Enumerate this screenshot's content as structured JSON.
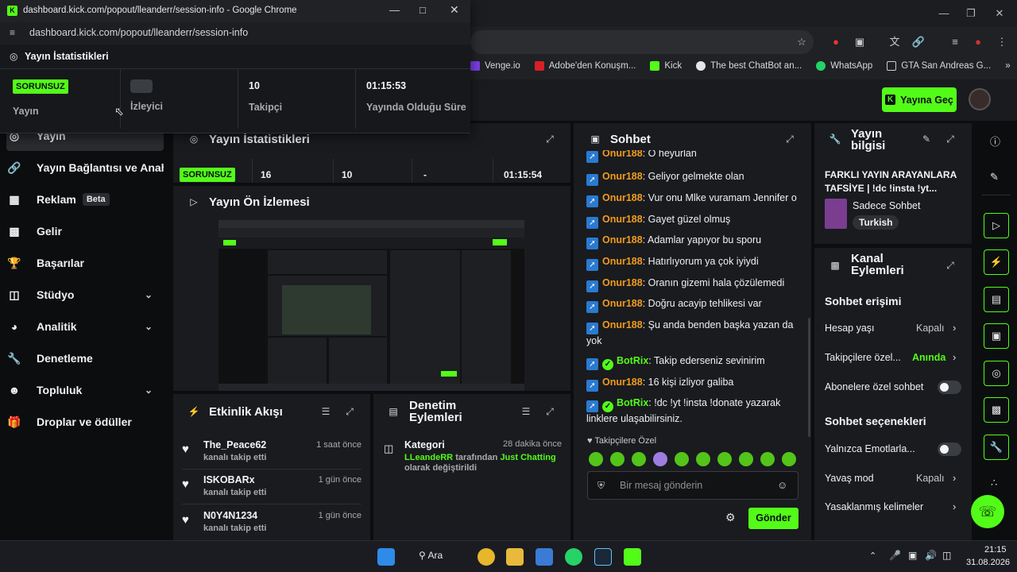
{
  "popout": {
    "window_title": "dashboard.kick.com/popout/lleanderr/session-info - Google Chrome",
    "url": "dashboard.kick.com/popout/lleanderr/session-info",
    "header": "Yayın İstatistikleri",
    "stats": [
      {
        "value": "SORUNSUZ",
        "label": "Yayın"
      },
      {
        "value": "",
        "label": "İzleyici"
      },
      {
        "value": "10",
        "label": "Takipçi"
      },
      {
        "value": "01:15:53",
        "label": "Yayında Olduğu Süre"
      }
    ]
  },
  "browser": {
    "bookmarks": [
      "Venge.io",
      "Adobe'den Konuşm...",
      "Kick",
      "The best ChatBot an...",
      "WhatsApp",
      "GTA San Andreas G..."
    ]
  },
  "header": {
    "go_live": "Yayına Geç"
  },
  "sidebar": {
    "items": [
      {
        "label": "Yayın",
        "icon": "broadcast-icon"
      },
      {
        "label": "Yayın Bağlantısı ve Anahtarı",
        "icon": "link-icon"
      },
      {
        "label": "Reklam",
        "icon": "ad-icon",
        "badge": "Beta"
      },
      {
        "label": "Gelir",
        "icon": "wallet-icon"
      },
      {
        "label": "Başarılar",
        "icon": "trophy-icon"
      },
      {
        "label": "Stüdyo",
        "icon": "studio-icon",
        "expandable": true
      },
      {
        "label": "Analitik",
        "icon": "analytics-icon",
        "expandable": true
      },
      {
        "label": "Denetleme",
        "icon": "wrench-icon"
      },
      {
        "label": "Topluluk",
        "icon": "community-icon",
        "expandable": true
      },
      {
        "label": "Droplar ve ödüller",
        "icon": "gift-icon"
      }
    ]
  },
  "stream_stats": {
    "title": "Yayın İstatistikleri",
    "values": [
      "SORUNSUZ",
      "16",
      "10",
      "-",
      "01:15:54"
    ]
  },
  "preview": {
    "title": "Yayın Ön İzlemesi"
  },
  "activity": {
    "title": "Etkinlik Akışı",
    "events": [
      {
        "name": "The_Peace62",
        "action": "kanalı takip etti",
        "time": "1 saat önce"
      },
      {
        "name": "ISKOBARx",
        "action": "kanalı takip etti",
        "time": "1 gün önce"
      },
      {
        "name": "N0Y4N1234",
        "action": "kanalı takip etti",
        "time": "1 gün önce"
      }
    ]
  },
  "moderation": {
    "title_line1": "Denetim",
    "title_line2": "Eylemleri",
    "entry": {
      "title": "Kategori",
      "time": "28 dakika önce",
      "user": "LLeandeRR",
      "middle": "tarafından",
      "category": "Just Chatting",
      "tail": "olarak değiştirildi"
    }
  },
  "chat": {
    "title": "Sohbet",
    "messages": [
      {
        "user": "Onur188",
        "text": "O heyurlan",
        "bot": false
      },
      {
        "user": "Onur188",
        "text": "Geliyor gelmekte olan",
        "bot": false
      },
      {
        "user": "Onur188",
        "text": "Vur onu Mlke vuramam Jennifer o",
        "bot": false
      },
      {
        "user": "Onur188",
        "text": "Gayet güzel olmuş",
        "bot": false
      },
      {
        "user": "Onur188",
        "text": "Adamlar yapıyor bu sporu",
        "bot": false
      },
      {
        "user": "Onur188",
        "text": "Hatırlıyorum ya çok iyiydi",
        "bot": false
      },
      {
        "user": "Onur188",
        "text": "Oranın gizemi hala çözülemedi",
        "bot": false
      },
      {
        "user": "Onur188",
        "text": "Doğru acayip tehlikesi var",
        "bot": false
      },
      {
        "user": "Onur188",
        "text": "Şu anda benden başka yazan da yok",
        "bot": false
      },
      {
        "user": "BotRix",
        "text": "Takip ederseniz sevinirim",
        "bot": true
      },
      {
        "user": "Onur188",
        "text": "16 kişi izliyor galiba",
        "bot": false
      },
      {
        "user": "BotRix",
        "text": "!dc !yt !insta !donate yazarak linklere ulaşabilirsiniz.",
        "bot": true
      }
    ],
    "followers_only": "Takipçilere Özel",
    "placeholder": "Bir mesaj gönderin",
    "send": "Gönder"
  },
  "stream_info": {
    "title_line1": "Yayın",
    "title_line2": "bilgisi",
    "stream_title": "FARKLI YAYIN ARAYANLARA TAFSİYE | !dc !insta !yt...",
    "category": "Sadece Sohbet",
    "language": "Turkish"
  },
  "channel_actions": {
    "title_line1": "Kanal",
    "title_line2": "Eylemleri",
    "chat_access": "Sohbet erişimi",
    "account_age": {
      "label": "Hesap yaşı",
      "value": "Kapalı"
    },
    "followers_only": {
      "label": "Takipçilere özel...",
      "value": "Anında"
    },
    "subscribers_only": "Abonelere özel sohbet",
    "chat_options": "Sohbet seçenekleri",
    "emotes_only": "Yalnızca Emotlarla...",
    "slow_mode": {
      "label": "Yavaş mod",
      "value": "Kapalı"
    },
    "banned_words": "Yasaklanmış kelimeler"
  },
  "taskbar": {
    "search": "Ara",
    "time": "21:15",
    "date": "31.08.2026"
  },
  "colors": {
    "accent": "#53fc18",
    "username": "#f29b1d",
    "panel": "#191b1f",
    "bg": "#0b0d0f"
  }
}
